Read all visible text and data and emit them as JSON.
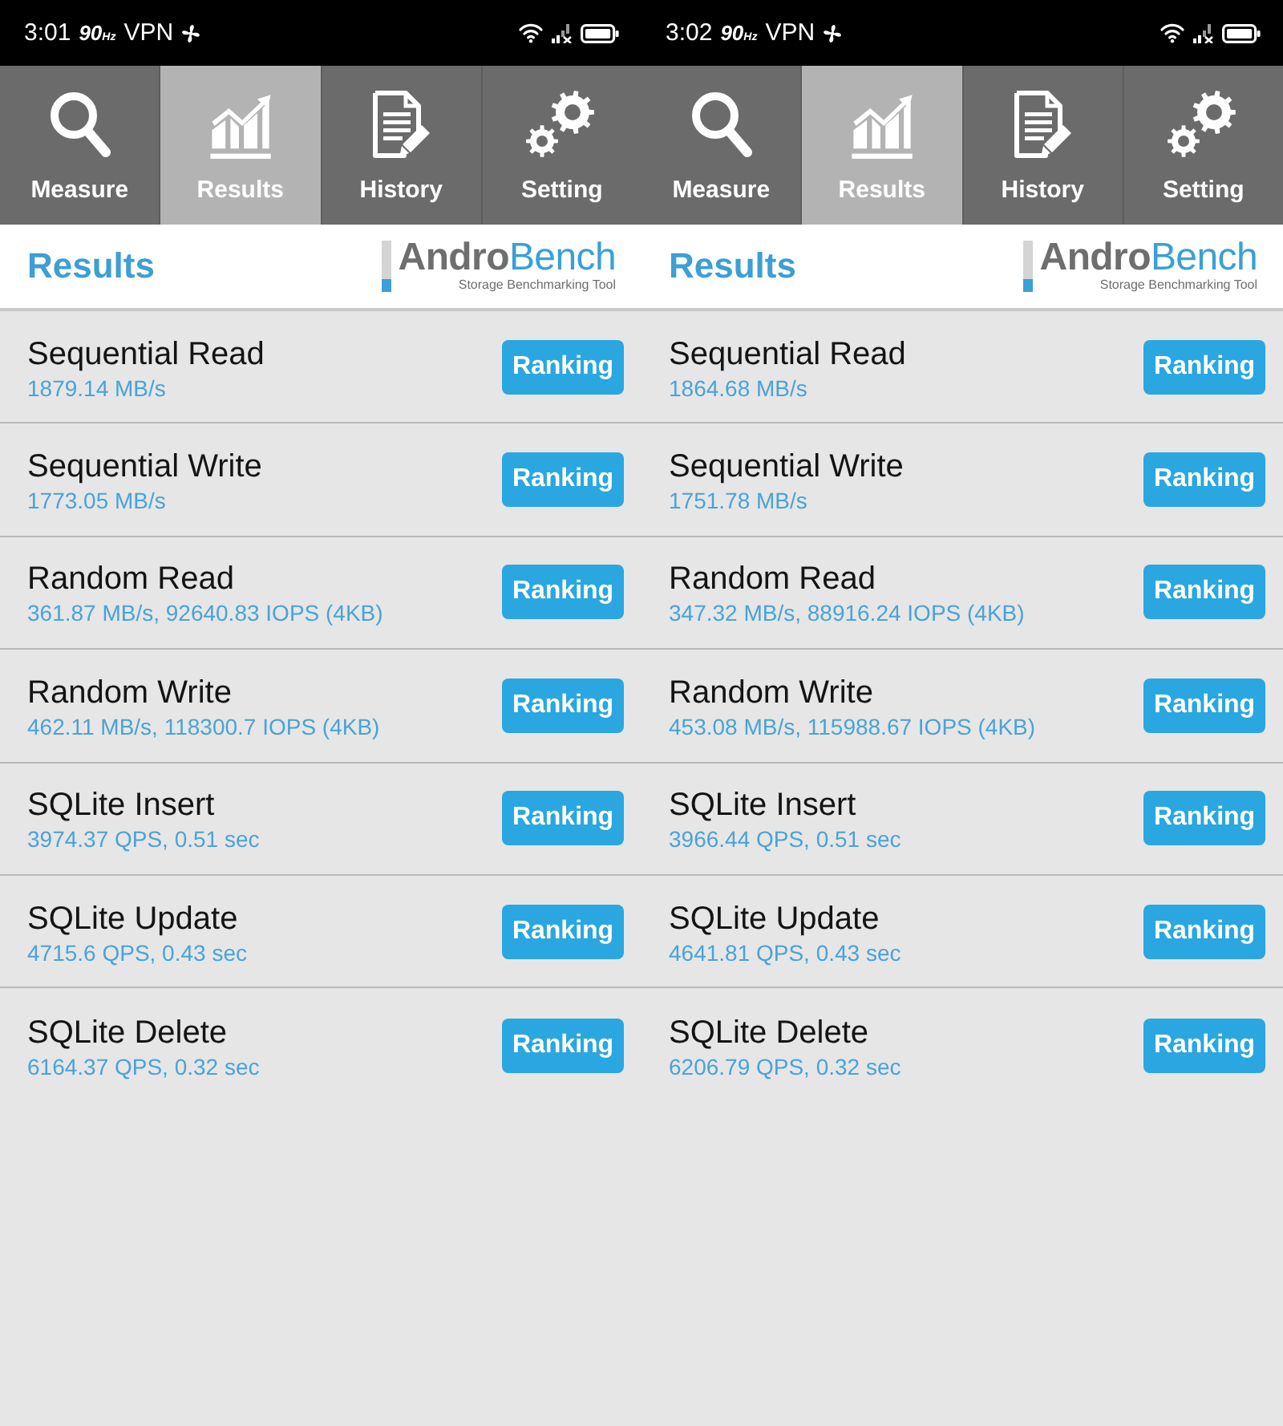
{
  "screens": [
    {
      "status_bar": {
        "time": "3:01",
        "refresh_rate": "90$_{Hz}$",
        "vpn": "VPN"
      },
      "tabs": [
        {
          "label": "Measure",
          "selected": false
        },
        {
          "label": "Results",
          "selected": true
        },
        {
          "label": "History",
          "selected": false
        },
        {
          "label": "Setting",
          "selected": false
        }
      ],
      "header": {
        "title": "Results",
        "logo": "**Andro**Bench",
        "tagline": "Storage Benchmarking Tool"
      },
      "results": [
        {
          "name": "Sequential Read",
          "value": "1879.14 MB/s",
          "button": "Ranking"
        },
        {
          "name": "Sequential Write",
          "value": "1773.05 MB/s",
          "button": "Ranking"
        },
        {
          "name": "Random Read",
          "value": "361.87 MB/s, 92640.83 IOPS (4KB)",
          "button": "Ranking"
        },
        {
          "name": "Random Write",
          "value": "462.11 MB/s, 118300.7 IOPS (4KB)",
          "button": "Ranking"
        },
        {
          "name": "SQLite Insert",
          "value": "3974.37 QPS, 0.51 sec",
          "button": "Ranking"
        },
        {
          "name": "SQLite Update",
          "value": "4715.6 QPS, 0.43 sec",
          "button": "Ranking"
        },
        {
          "name": "SQLite Delete",
          "value": "6164.37 QPS, 0.32 sec",
          "button": "Ranking"
        }
      ]
    },
    {
      "status_bar": {
        "time": "3:02",
        "refresh_rate": "90$_{Hz}$",
        "vpn": "VPN"
      },
      "tabs": [
        {
          "label": "Measure",
          "selected": false
        },
        {
          "label": "Results",
          "selected": true
        },
        {
          "label": "History",
          "selected": false
        },
        {
          "label": "Setting",
          "selected": false
        }
      ],
      "header": {
        "title": "Results",
        "logo": "**Andro**Bench",
        "tagline": "Storage Benchmarking Tool"
      },
      "results": [
        {
          "name": "Sequential Read",
          "value": "1864.68 MB/s",
          "button": "Ranking"
        },
        {
          "name": "Sequential Write",
          "value": "1751.78 MB/s",
          "button": "Ranking"
        },
        {
          "name": "Random Read",
          "value": "347.32 MB/s, 88916.24 IOPS (4KB)",
          "button": "Ranking"
        },
        {
          "name": "Random Write",
          "value": "453.08 MB/s, 115988.67 IOPS (4KB)",
          "button": "Ranking"
        },
        {
          "name": "SQLite Insert",
          "value": "3966.44 QPS, 0.51 sec",
          "button": "Ranking"
        },
        {
          "name": "SQLite Update",
          "value": "4641.81 QPS, 0.43 sec",
          "button": "Ranking"
        },
        {
          "name": "SQLite Delete",
          "value": "6206.79 QPS, 0.32 sec",
          "button": "Ranking"
        }
      ]
    }
  ]
}
